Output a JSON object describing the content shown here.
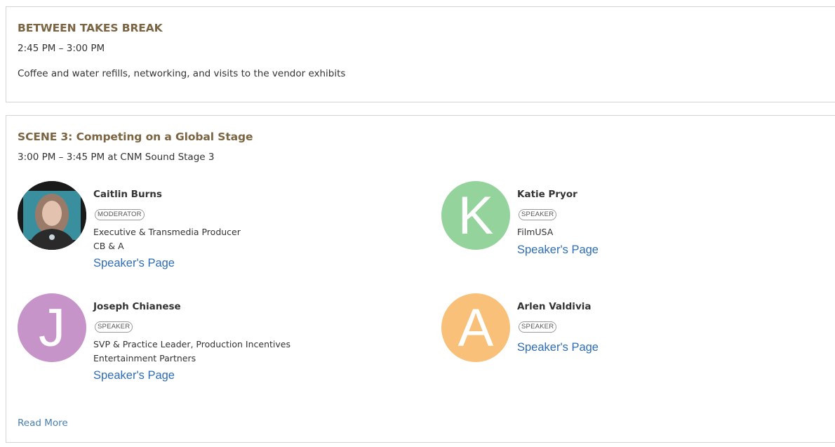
{
  "break_session": {
    "title": "BETWEEN TAKES BREAK",
    "time": "2:45 PM – 3:00 PM",
    "description": "Coffee and water refills, networking, and visits to the vendor exhibits"
  },
  "scene_session": {
    "title": "SCENE 3: Competing on a Global Stage",
    "time": "3:00 PM – 3:45 PM",
    "location_prefix": "at",
    "location": "CNM Sound Stage 3",
    "read_more": "Read More",
    "speakers": [
      {
        "name": "Caitlin Burns",
        "role": "MODERATOR",
        "title": "Executive & Transmedia Producer",
        "company": "CB & A",
        "link": "Speaker's Page",
        "avatar_type": "photo"
      },
      {
        "name": "Katie Pryor",
        "role": "SPEAKER",
        "company": "FilmUSA",
        "link": "Speaker's Page",
        "avatar_letter": "K",
        "avatar_color": "#94d39b"
      },
      {
        "name": "Joseph Chianese",
        "role": "SPEAKER",
        "title": "SVP & Practice Leader, Production Incentives",
        "company": "Entertainment Partners",
        "link": "Speaker's Page",
        "avatar_letter": "J",
        "avatar_color": "#c694c8"
      },
      {
        "name": "Arlen Valdivia",
        "role": "SPEAKER",
        "link": "Speaker's Page",
        "avatar_letter": "A",
        "avatar_color": "#f9c07a"
      }
    ]
  }
}
